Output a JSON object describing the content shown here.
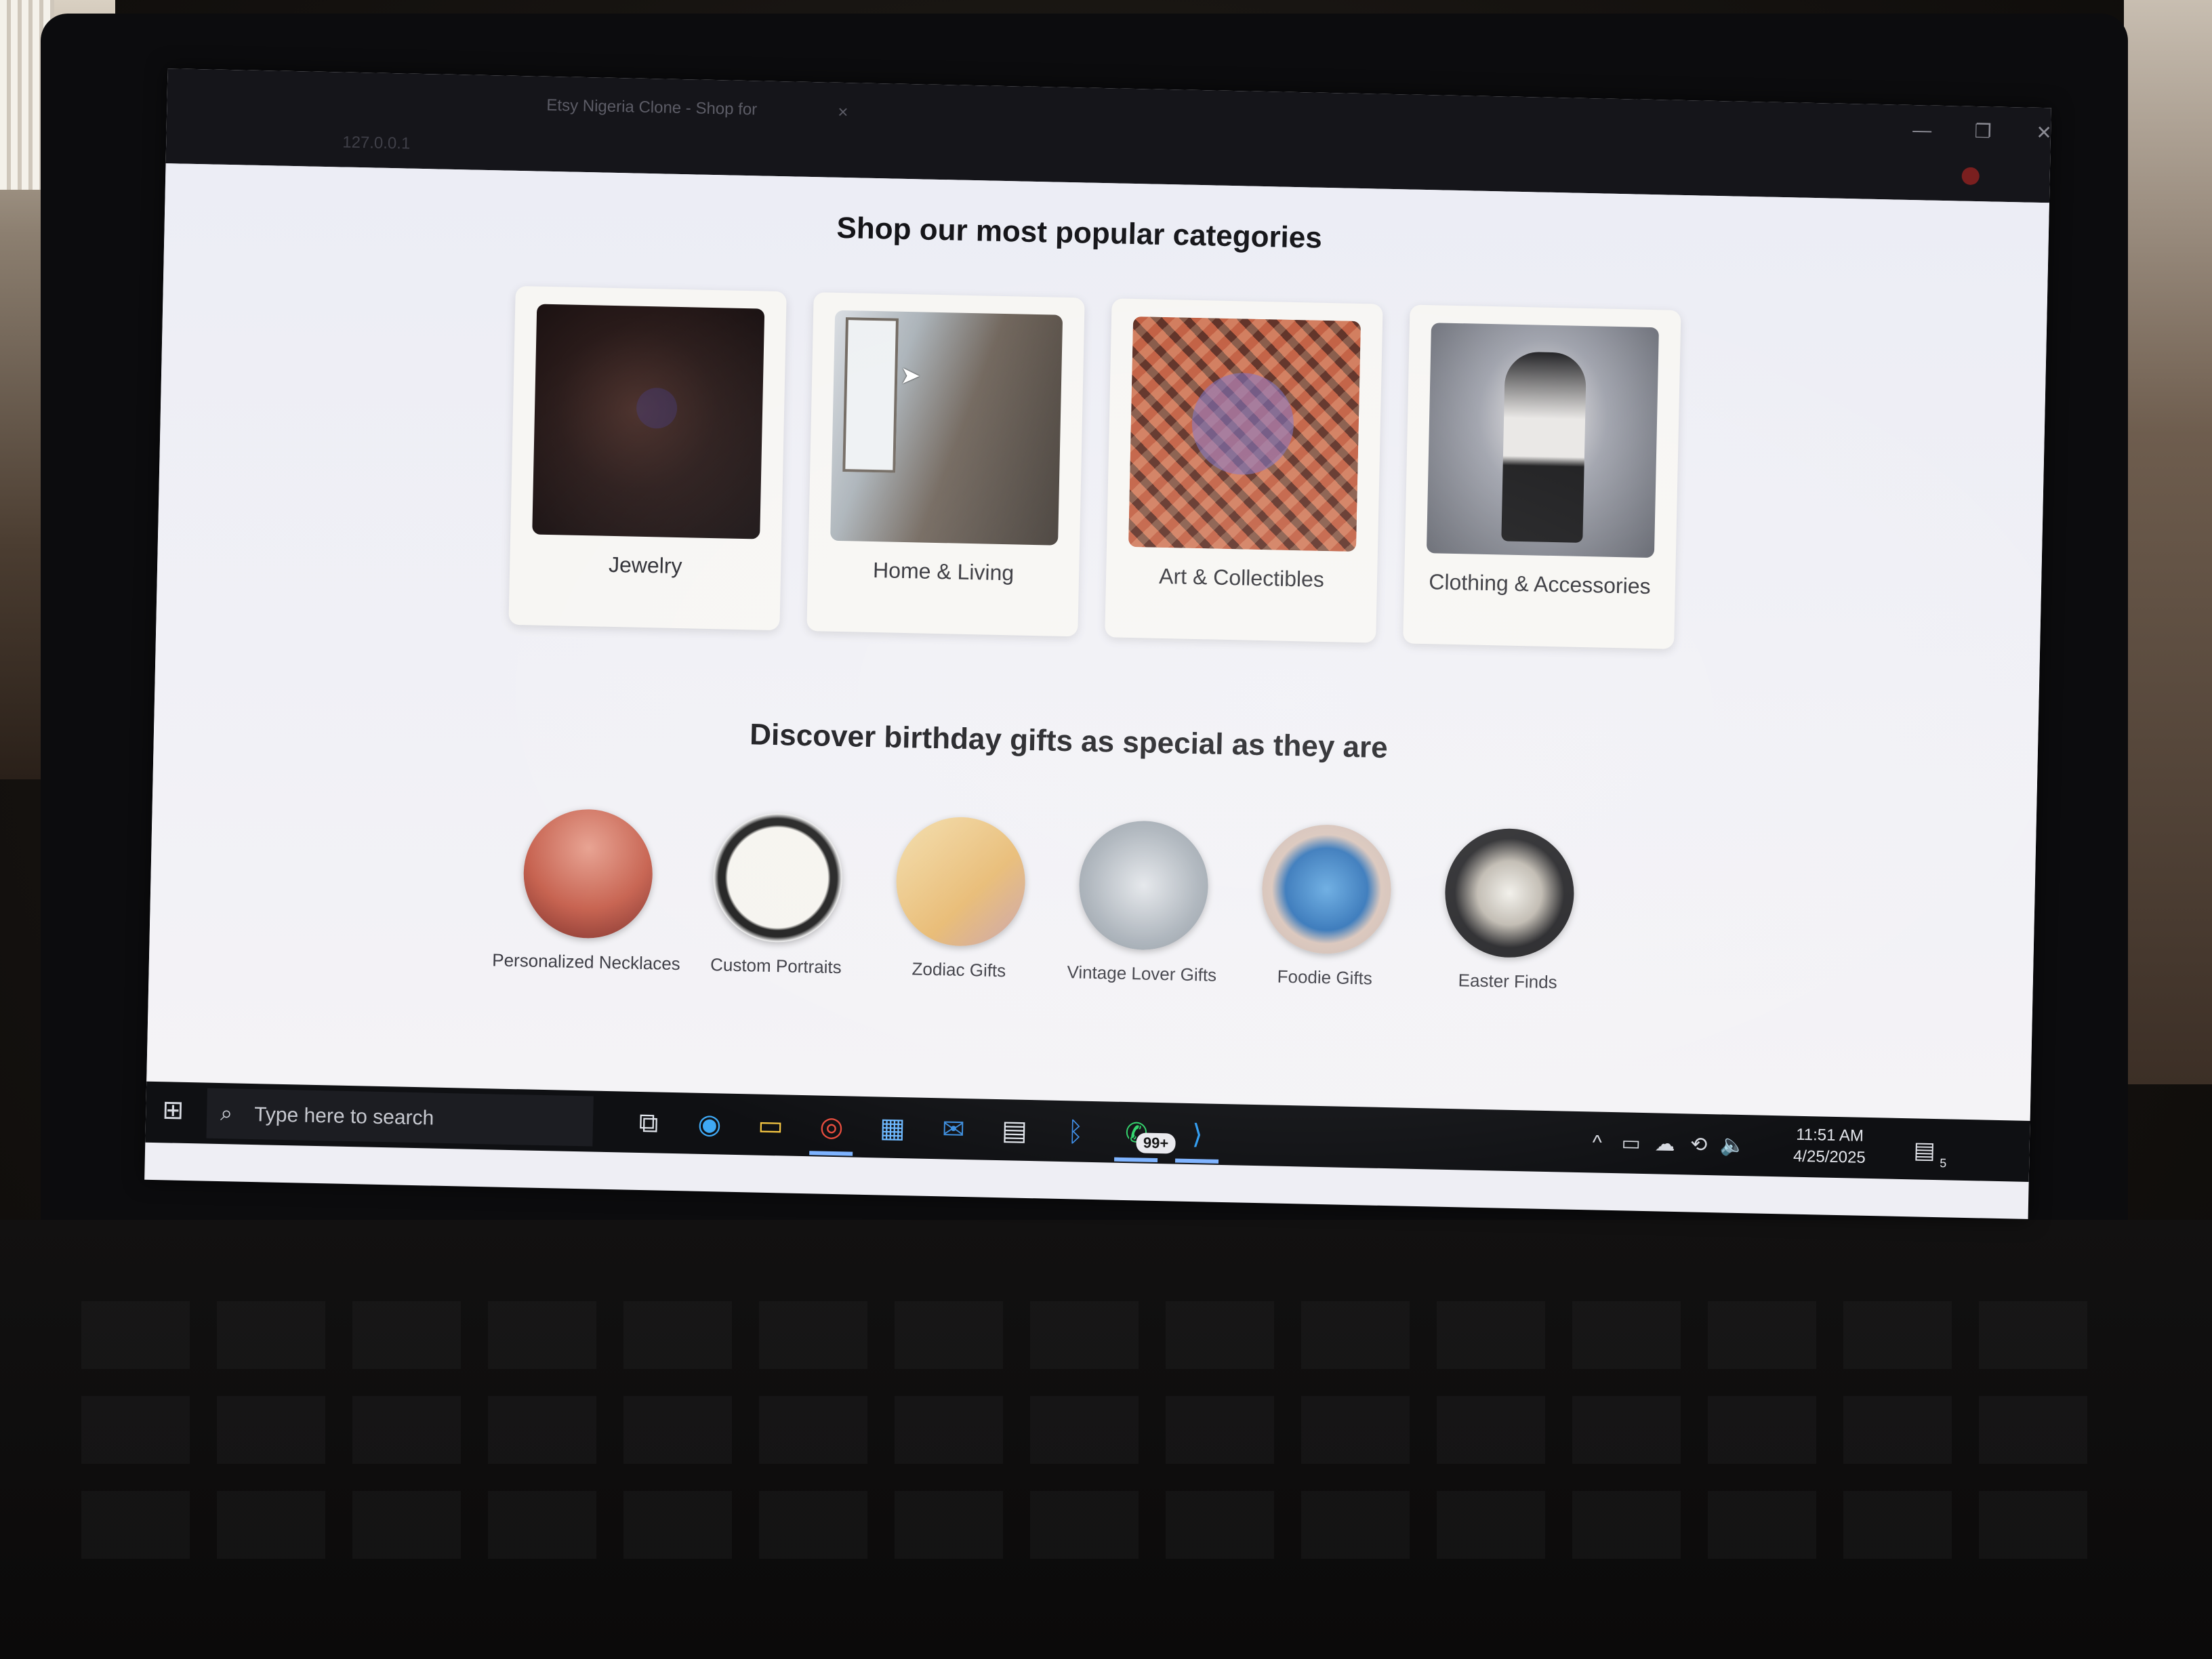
{
  "browser": {
    "tab_title": "Etsy Nigeria Clone - Shop for",
    "tab_close": "×",
    "address": "127.0.0.1",
    "window_controls": {
      "minimize": "—",
      "restore": "❐",
      "close": "✕"
    }
  },
  "popular": {
    "title": "Shop our most popular categories",
    "categories": [
      {
        "label": "Jewelry",
        "icon": "jewelry-photo"
      },
      {
        "label": "Home & Living",
        "icon": "home-living-photo"
      },
      {
        "label": "Art & Collectibles",
        "icon": "art-collectibles-photo"
      },
      {
        "label": "Clothing & Accessories",
        "icon": "clothing-photo"
      }
    ]
  },
  "birthday": {
    "title": "Discover birthday gifts as special as they are",
    "gifts": [
      {
        "label": "Personalized Necklaces"
      },
      {
        "label": "Custom Portraits"
      },
      {
        "label": "Zodiac Gifts"
      },
      {
        "label": "Vintage Lover Gifts"
      },
      {
        "label": "Foodie Gifts"
      },
      {
        "label": "Easter Finds"
      }
    ]
  },
  "taskbar": {
    "search_placeholder": "Type here to search",
    "start_icon": "⊞",
    "search_icon": "⌕",
    "apps": [
      {
        "name": "task-view-icon",
        "glyph": "⧉"
      },
      {
        "name": "edge-icon",
        "glyph": "◉"
      },
      {
        "name": "file-explorer-icon",
        "glyph": "▭"
      },
      {
        "name": "chrome-icon",
        "glyph": "◎"
      },
      {
        "name": "store-icon",
        "glyph": "▦"
      },
      {
        "name": "mail-icon",
        "glyph": "✉"
      },
      {
        "name": "calculator-icon",
        "glyph": "▤"
      },
      {
        "name": "bluetooth-icon",
        "glyph": "ᛒ"
      },
      {
        "name": "whatsapp-icon",
        "glyph": "✆"
      },
      {
        "name": "vscode-icon",
        "glyph": "⟩"
      }
    ],
    "whatsapp_badge": "99+",
    "tray_icons": [
      "^",
      "▭",
      "☁",
      "⟲",
      "🔈"
    ],
    "time": "11:51 AM",
    "date": "4/25/2025",
    "notification_icon": "▤",
    "notification_count": "5"
  },
  "cursor": "➤"
}
